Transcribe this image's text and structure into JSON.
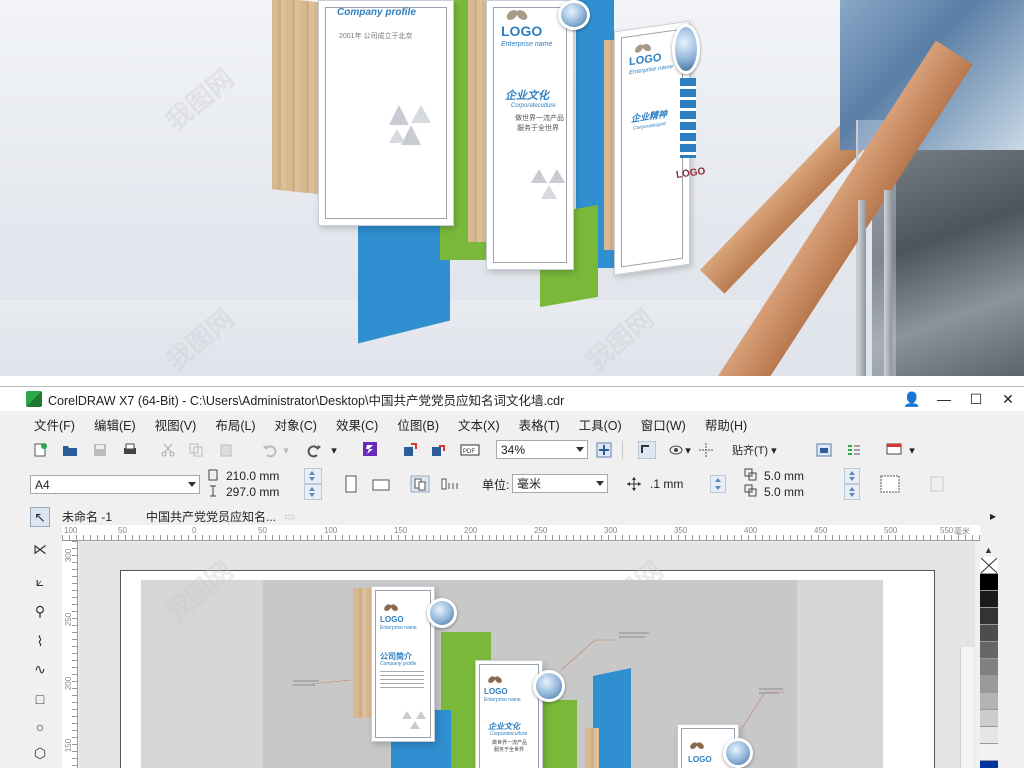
{
  "photo": {
    "frames": [
      {
        "logo": "",
        "enterprise": "Company profile",
        "subtitle": "2001年 公司成立于北京"
      },
      {
        "logo": "LOGO",
        "enterprise": "Enterprise name",
        "heading": "企业文化",
        "subheading": "Corporateculture",
        "line1": "做世界一流产品",
        "line2": "服务于全世界"
      },
      {
        "logo": "LOGO",
        "enterprise": "Enterprise name",
        "heading": "企业精神",
        "subheading": "Corporatespirit"
      }
    ],
    "side_logo": "LOGO"
  },
  "app": {
    "title": "CorelDRAW X7 (64-Bit) - C:\\Users\\Administrator\\Desktop\\中国共产党党员应知名词文化墙.cdr",
    "window_controls": {
      "minimize": "—",
      "maximize": "☐",
      "close": "✕"
    },
    "menu": [
      "文件(F)",
      "编辑(E)",
      "视图(V)",
      "布局(L)",
      "对象(C)",
      "效果(C)",
      "位图(B)",
      "文本(X)",
      "表格(T)",
      "工具(O)",
      "窗口(W)",
      "帮助(H)"
    ],
    "toolbar": {
      "zoom": "34%",
      "snap_label": "贴齐(T)"
    },
    "property_bar": {
      "page_size": "A4",
      "width": "210.0 mm",
      "height": "297.0 mm",
      "units_label": "单位:",
      "units": "毫米",
      "nudge": ".1 mm",
      "dup_x": "5.0 mm",
      "dup_y": "5.0 mm"
    },
    "doc_tabs": [
      "未命名 -1",
      "中国共产党党员应知名..."
    ],
    "ruler_h": [
      "100",
      "50",
      "0",
      "50",
      "100",
      "150",
      "200",
      "250",
      "300",
      "350",
      "400",
      "450",
      "500",
      "550"
    ],
    "ruler_unit": "毫米",
    "ruler_v": [
      "300",
      "250",
      "200",
      "150"
    ],
    "artwork": {
      "frame1": {
        "logo": "LOGO",
        "enterprise": "Enterprise name",
        "heading": "公司简介",
        "subheading": "Company profile"
      },
      "frame2": {
        "logo": "LOGO",
        "enterprise": "Enterprise name",
        "heading": "企业文化",
        "subheading": "Corporateculture",
        "line1": "做世界一流产品",
        "line2": "服务于全世界"
      },
      "frame3": {
        "logo": "LOGO"
      }
    },
    "palette": [
      "#ffffff",
      "#000000",
      "#1a1a1a",
      "#333333",
      "#4d4d4d",
      "#666666",
      "#808080",
      "#999999",
      "#b3b3b3",
      "#cccccc",
      "#e6e6e6",
      "#f2f2f2",
      "#0033a0"
    ]
  },
  "watermark": "我图网"
}
